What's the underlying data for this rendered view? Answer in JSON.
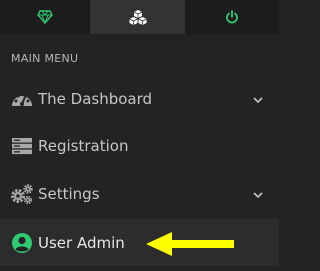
{
  "topbar": {
    "tabs": [
      {
        "icon": "diamond-icon",
        "color": "#2ecc71"
      },
      {
        "icon": "cubes-icon",
        "color": "#ffffff"
      },
      {
        "icon": "power-icon",
        "color": "#2ecc71"
      }
    ]
  },
  "sidebar": {
    "section_label": "MAIN MENU",
    "items": [
      {
        "label": "The Dashboard",
        "icon": "dashboard-icon",
        "has_chevron": true
      },
      {
        "label": "Registration",
        "icon": "server-icon",
        "has_chevron": false
      },
      {
        "label": "Settings",
        "icon": "cogs-icon",
        "has_chevron": true
      },
      {
        "label": "User Admin",
        "icon": "user-circle-icon",
        "icon_color": "#2ecc71",
        "active": true
      }
    ]
  },
  "annotation": {
    "icon": "arrow-left-icon",
    "color": "#ffff00"
  }
}
